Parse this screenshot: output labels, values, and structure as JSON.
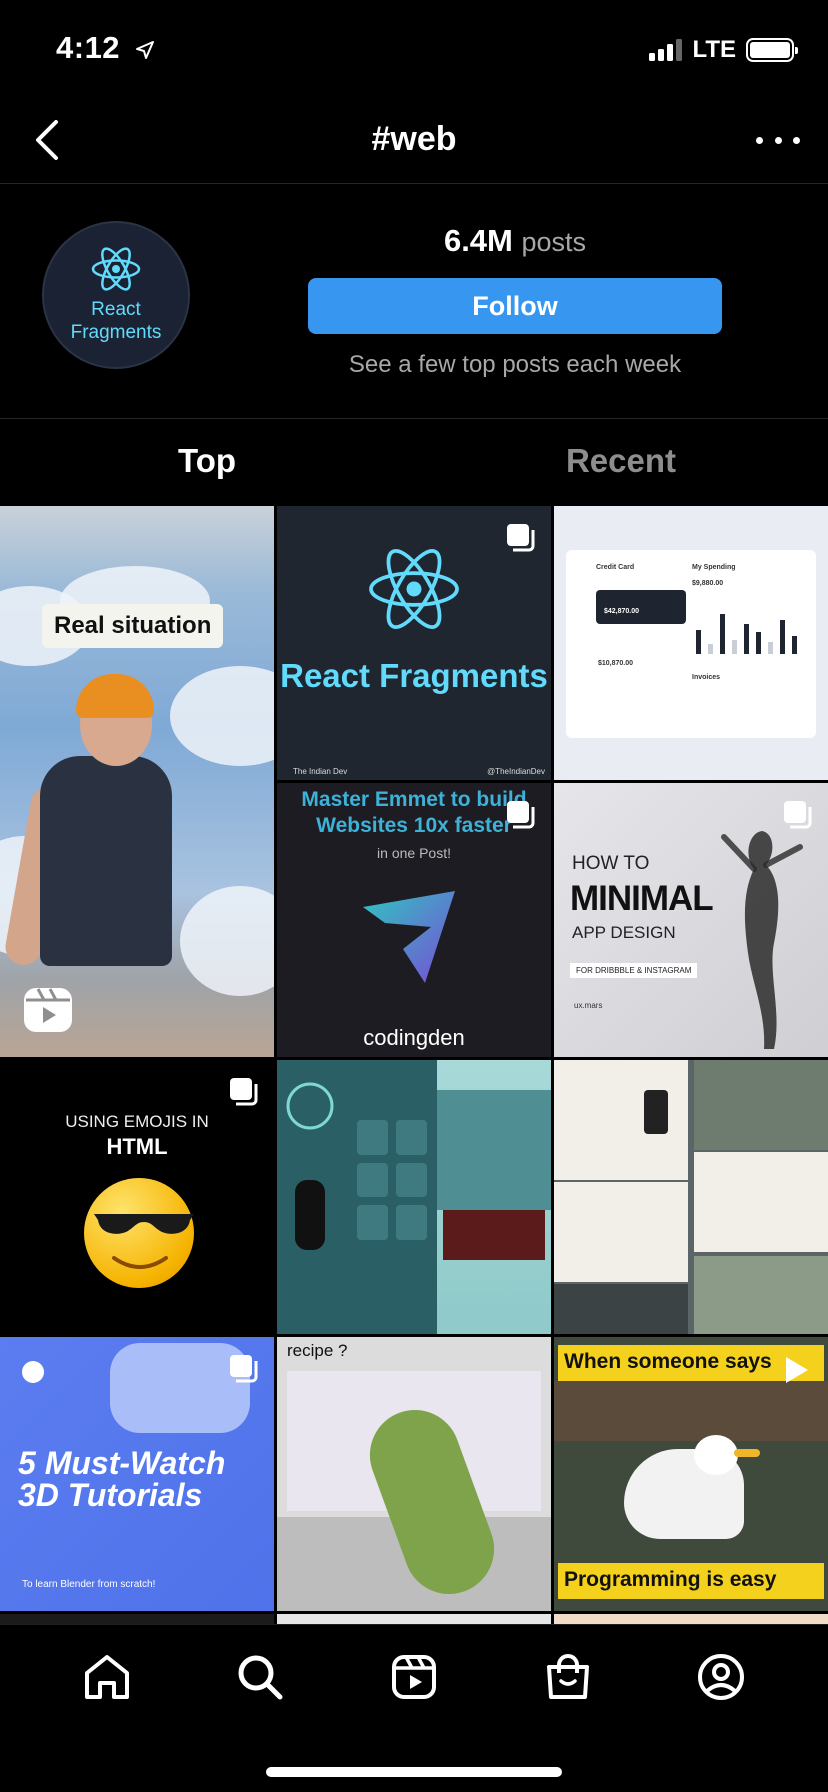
{
  "status": {
    "time": "4:12",
    "network": "LTE"
  },
  "nav": {
    "title": "#web"
  },
  "header": {
    "avatar_text": "React Fragments",
    "post_count": "6.4M",
    "post_label": "posts",
    "follow_label": "Follow",
    "subtitle": "See a few top posts each week"
  },
  "tabs": {
    "top": "Top",
    "recent": "Recent"
  },
  "grid": {
    "t1_caption": "Real situation",
    "t2_text": "React Fragments",
    "t2_left": "The Indian Dev",
    "t2_right": "@TheIndianDev",
    "t3_card": "Credit Card",
    "t3_spending": "My Spending",
    "t3_amount1": "$42,870.00",
    "t3_amount2": "$10,870.00",
    "t3_amount3": "$9,880.00",
    "t3_invoices": "Invoices",
    "t4_title": "Master Emmet to build Websites 10x faster",
    "t4_sub": "in one Post!",
    "t4_brand": "codingden",
    "t5_l1": "HOW TO",
    "t5_l2": "MINIMAL",
    "t5_l3": "APP DESIGN",
    "t5_l4": "FOR DRIBBBLE & INSTAGRAM",
    "t5_l5": "ux.mars",
    "t6_l1": "USING EMOJIS IN",
    "t6_l2": "HTML",
    "t9_title": "5 Must-Watch 3D Tutorials",
    "t9_sub": "To learn Blender from scratch!",
    "t10_q": "recipe ?",
    "t11_top": "When someone says",
    "t11_bot": "Programming is easy"
  },
  "colors": {
    "accent": "#3797f0",
    "react": "#61dafb",
    "meme": "#f4d11d"
  }
}
